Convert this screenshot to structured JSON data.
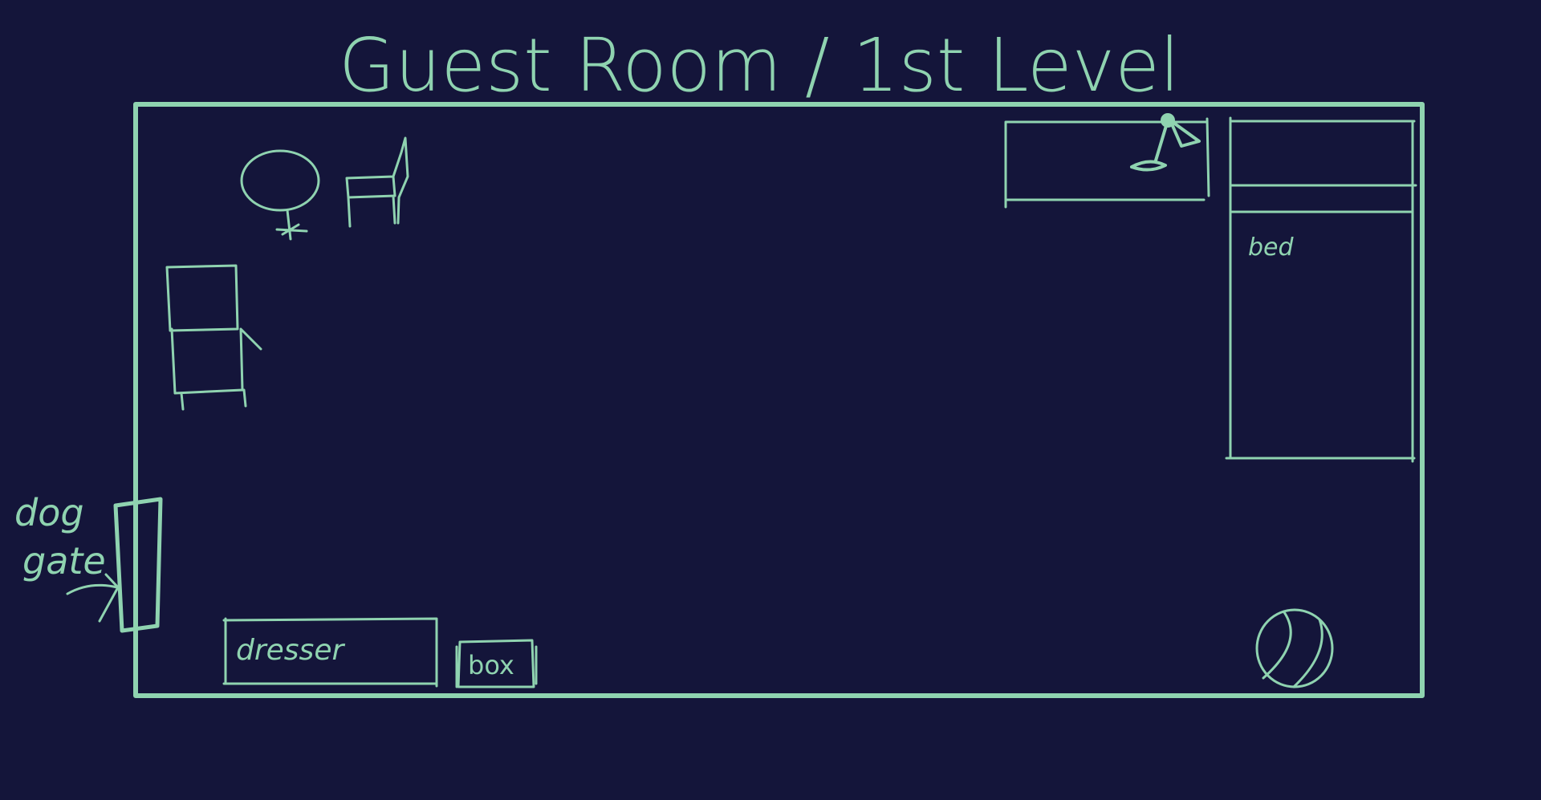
{
  "title": "Guest Room / 1st Level",
  "labels": {
    "bed": "bed",
    "dresser": "dresser",
    "box": "box",
    "dog_gate_line1": "dog",
    "dog_gate_line2": "gate"
  },
  "colors": {
    "background": "#14153a",
    "ink": "#8fd3b0"
  }
}
